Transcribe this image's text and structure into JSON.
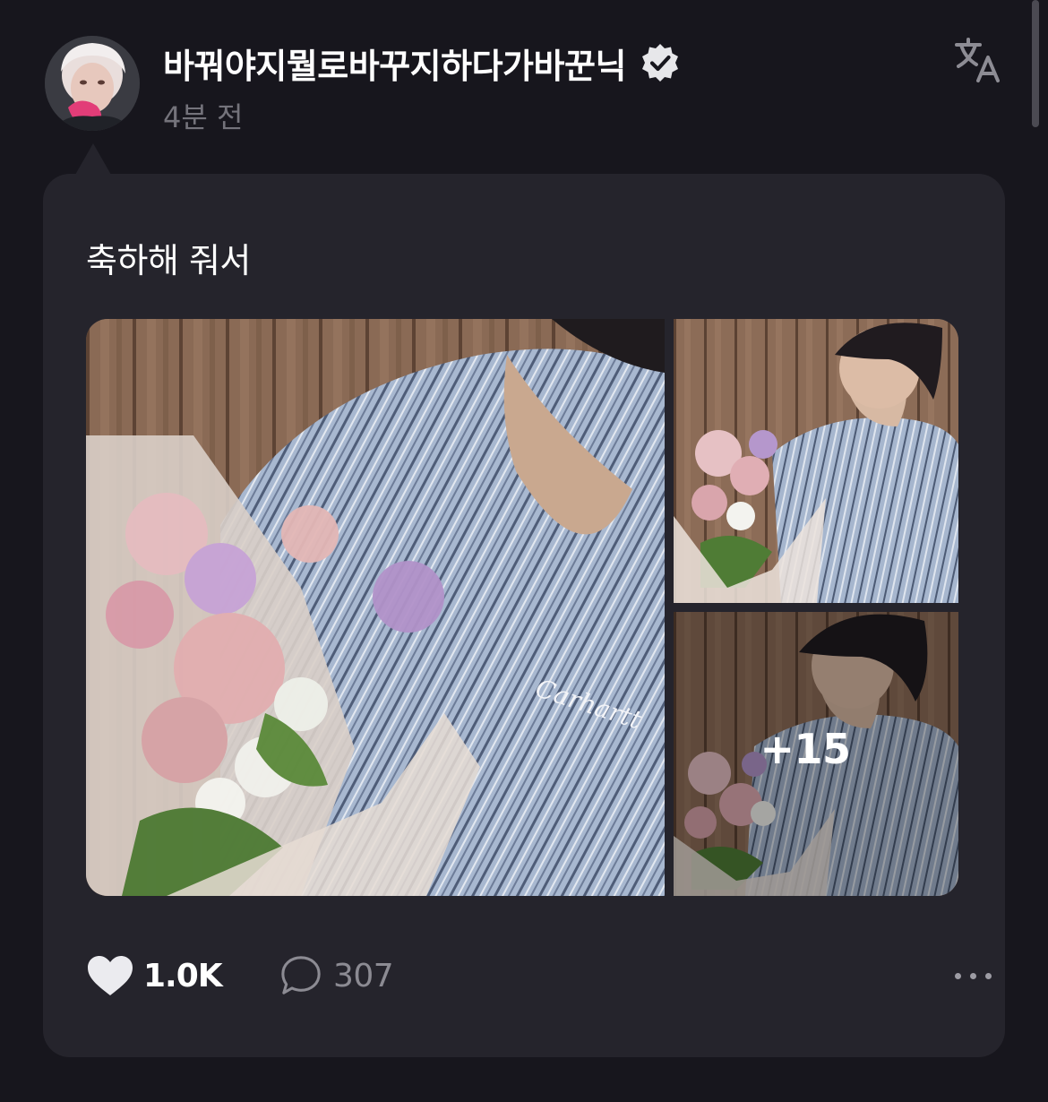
{
  "header": {
    "username": "바꿔야지뭘로바꾸지하다가바꾼닉",
    "time_ago": "4분 전",
    "verified_icon": "verified-badge-icon",
    "translate_icon": "translate-icon"
  },
  "post": {
    "text": "축하해 줘서",
    "images": [
      {
        "name": "photo-1",
        "description_icon": "photo"
      },
      {
        "name": "photo-2",
        "description_icon": "photo"
      },
      {
        "name": "photo-3",
        "description_icon": "photo"
      }
    ],
    "more_images_label": "+15"
  },
  "actions": {
    "like_icon": "heart-icon",
    "like_count": "1.0K",
    "comment_icon": "comment-bubble-icon",
    "comment_count": "307",
    "more_icon": "more-dots-icon"
  },
  "colors": {
    "background": "#17161d",
    "card": "#25242c",
    "secondary_text": "#74737b",
    "comment_count_text": "#8c8b93"
  }
}
